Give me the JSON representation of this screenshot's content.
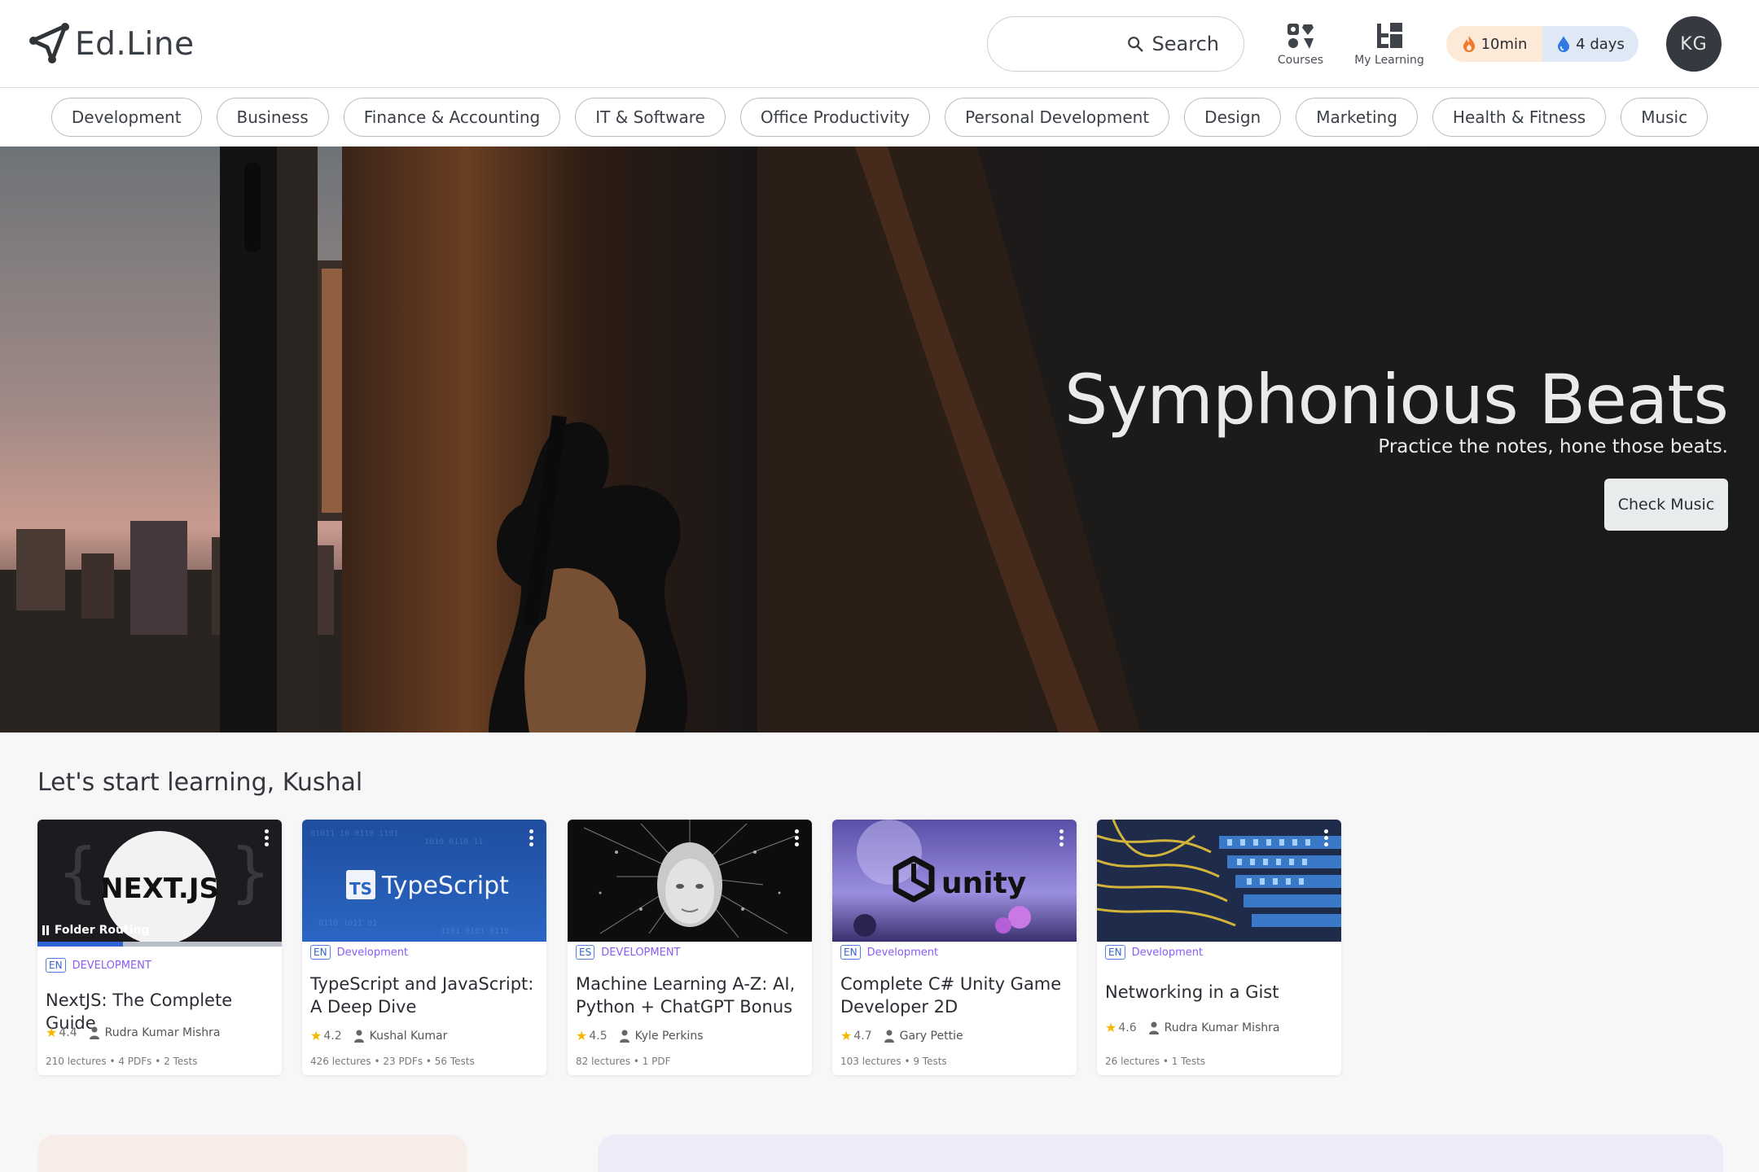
{
  "brand": {
    "name": "Ed.Line"
  },
  "header": {
    "search_label": "Search",
    "nav": [
      {
        "label": "Courses",
        "icon": "courses-icon"
      },
      {
        "label": "My Learning",
        "icon": "my-learning-icon"
      }
    ],
    "stats": {
      "time": "10min",
      "streak": "4 days"
    },
    "avatar_initials": "KG"
  },
  "categories": [
    "Development",
    "Business",
    "Finance & Accounting",
    "IT & Software",
    "Office Productivity",
    "Personal Development",
    "Design",
    "Marketing",
    "Health & Fitness",
    "Music"
  ],
  "hero": {
    "title": "Symphonious Beats",
    "subtitle": "Practice the notes, hone those beats.",
    "cta": "Check Music"
  },
  "learning": {
    "heading": "Let's start learning, Kushal",
    "courses": [
      {
        "thumb_text": "NEXT.JS",
        "lesson": "Folder Routing",
        "progress": 0.35,
        "lang": "EN",
        "category": "DEVELOPMENT",
        "title": "NextJS: The Complete Guide",
        "rating": "4.4",
        "author": "Rudra Kumar Mishra",
        "lectures": "210 lectures • 4 PDFs • 2 Tests"
      },
      {
        "thumb_text": "TypeScript",
        "lang": "EN",
        "category": "Development",
        "title": "TypeScript and JavaScript: A Deep Dive",
        "rating": "4.2",
        "author": "Kushal Kumar",
        "lectures": "426 lectures • 23 PDFs • 56 Tests"
      },
      {
        "lang": "ES",
        "category": "DEVELOPMENT",
        "title": "Machine Learning A-Z: AI, Python + ChatGPT Bonus",
        "rating": "4.5",
        "author": "Kyle Perkins",
        "lectures": "82 lectures • 1 PDF"
      },
      {
        "thumb_text": "unity",
        "lang": "EN",
        "category": "Development",
        "title": "Complete C# Unity Game Developer 2D",
        "rating": "4.7",
        "author": "Gary Pettie",
        "lectures": "103 lectures • 9 Tests"
      },
      {
        "lang": "EN",
        "category": "Development",
        "title": "Networking in a Gist",
        "rating": "4.6",
        "author": "Rudra Kumar Mishra",
        "lectures": "26 lectures • 1 Tests"
      }
    ]
  },
  "colors": {
    "accent": "#8a5cf5",
    "lang_badge": "#3565cc",
    "progress": "#2f63d6",
    "star": "#f5b700"
  }
}
